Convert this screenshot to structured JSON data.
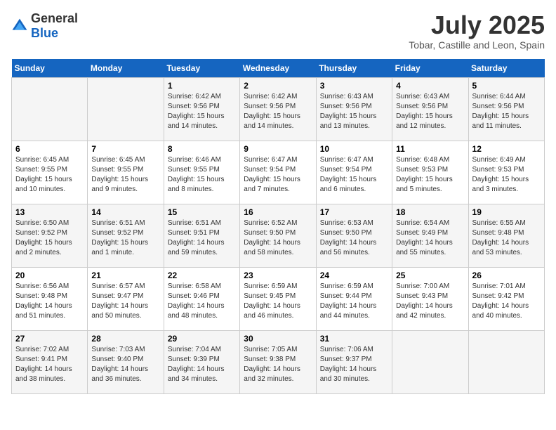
{
  "header": {
    "logo_general": "General",
    "logo_blue": "Blue",
    "month_year": "July 2025",
    "location": "Tobar, Castille and Leon, Spain"
  },
  "weekdays": [
    "Sunday",
    "Monday",
    "Tuesday",
    "Wednesday",
    "Thursday",
    "Friday",
    "Saturday"
  ],
  "weeks": [
    [
      {
        "day": "",
        "sunrise": "",
        "sunset": "",
        "daylight": ""
      },
      {
        "day": "",
        "sunrise": "",
        "sunset": "",
        "daylight": ""
      },
      {
        "day": "1",
        "sunrise": "Sunrise: 6:42 AM",
        "sunset": "Sunset: 9:56 PM",
        "daylight": "Daylight: 15 hours and 14 minutes."
      },
      {
        "day": "2",
        "sunrise": "Sunrise: 6:42 AM",
        "sunset": "Sunset: 9:56 PM",
        "daylight": "Daylight: 15 hours and 14 minutes."
      },
      {
        "day": "3",
        "sunrise": "Sunrise: 6:43 AM",
        "sunset": "Sunset: 9:56 PM",
        "daylight": "Daylight: 15 hours and 13 minutes."
      },
      {
        "day": "4",
        "sunrise": "Sunrise: 6:43 AM",
        "sunset": "Sunset: 9:56 PM",
        "daylight": "Daylight: 15 hours and 12 minutes."
      },
      {
        "day": "5",
        "sunrise": "Sunrise: 6:44 AM",
        "sunset": "Sunset: 9:56 PM",
        "daylight": "Daylight: 15 hours and 11 minutes."
      }
    ],
    [
      {
        "day": "6",
        "sunrise": "Sunrise: 6:45 AM",
        "sunset": "Sunset: 9:55 PM",
        "daylight": "Daylight: 15 hours and 10 minutes."
      },
      {
        "day": "7",
        "sunrise": "Sunrise: 6:45 AM",
        "sunset": "Sunset: 9:55 PM",
        "daylight": "Daylight: 15 hours and 9 minutes."
      },
      {
        "day": "8",
        "sunrise": "Sunrise: 6:46 AM",
        "sunset": "Sunset: 9:55 PM",
        "daylight": "Daylight: 15 hours and 8 minutes."
      },
      {
        "day": "9",
        "sunrise": "Sunrise: 6:47 AM",
        "sunset": "Sunset: 9:54 PM",
        "daylight": "Daylight: 15 hours and 7 minutes."
      },
      {
        "day": "10",
        "sunrise": "Sunrise: 6:47 AM",
        "sunset": "Sunset: 9:54 PM",
        "daylight": "Daylight: 15 hours and 6 minutes."
      },
      {
        "day": "11",
        "sunrise": "Sunrise: 6:48 AM",
        "sunset": "Sunset: 9:53 PM",
        "daylight": "Daylight: 15 hours and 5 minutes."
      },
      {
        "day": "12",
        "sunrise": "Sunrise: 6:49 AM",
        "sunset": "Sunset: 9:53 PM",
        "daylight": "Daylight: 15 hours and 3 minutes."
      }
    ],
    [
      {
        "day": "13",
        "sunrise": "Sunrise: 6:50 AM",
        "sunset": "Sunset: 9:52 PM",
        "daylight": "Daylight: 15 hours and 2 minutes."
      },
      {
        "day": "14",
        "sunrise": "Sunrise: 6:51 AM",
        "sunset": "Sunset: 9:52 PM",
        "daylight": "Daylight: 15 hours and 1 minute."
      },
      {
        "day": "15",
        "sunrise": "Sunrise: 6:51 AM",
        "sunset": "Sunset: 9:51 PM",
        "daylight": "Daylight: 14 hours and 59 minutes."
      },
      {
        "day": "16",
        "sunrise": "Sunrise: 6:52 AM",
        "sunset": "Sunset: 9:50 PM",
        "daylight": "Daylight: 14 hours and 58 minutes."
      },
      {
        "day": "17",
        "sunrise": "Sunrise: 6:53 AM",
        "sunset": "Sunset: 9:50 PM",
        "daylight": "Daylight: 14 hours and 56 minutes."
      },
      {
        "day": "18",
        "sunrise": "Sunrise: 6:54 AM",
        "sunset": "Sunset: 9:49 PM",
        "daylight": "Daylight: 14 hours and 55 minutes."
      },
      {
        "day": "19",
        "sunrise": "Sunrise: 6:55 AM",
        "sunset": "Sunset: 9:48 PM",
        "daylight": "Daylight: 14 hours and 53 minutes."
      }
    ],
    [
      {
        "day": "20",
        "sunrise": "Sunrise: 6:56 AM",
        "sunset": "Sunset: 9:48 PM",
        "daylight": "Daylight: 14 hours and 51 minutes."
      },
      {
        "day": "21",
        "sunrise": "Sunrise: 6:57 AM",
        "sunset": "Sunset: 9:47 PM",
        "daylight": "Daylight: 14 hours and 50 minutes."
      },
      {
        "day": "22",
        "sunrise": "Sunrise: 6:58 AM",
        "sunset": "Sunset: 9:46 PM",
        "daylight": "Daylight: 14 hours and 48 minutes."
      },
      {
        "day": "23",
        "sunrise": "Sunrise: 6:59 AM",
        "sunset": "Sunset: 9:45 PM",
        "daylight": "Daylight: 14 hours and 46 minutes."
      },
      {
        "day": "24",
        "sunrise": "Sunrise: 6:59 AM",
        "sunset": "Sunset: 9:44 PM",
        "daylight": "Daylight: 14 hours and 44 minutes."
      },
      {
        "day": "25",
        "sunrise": "Sunrise: 7:00 AM",
        "sunset": "Sunset: 9:43 PM",
        "daylight": "Daylight: 14 hours and 42 minutes."
      },
      {
        "day": "26",
        "sunrise": "Sunrise: 7:01 AM",
        "sunset": "Sunset: 9:42 PM",
        "daylight": "Daylight: 14 hours and 40 minutes."
      }
    ],
    [
      {
        "day": "27",
        "sunrise": "Sunrise: 7:02 AM",
        "sunset": "Sunset: 9:41 PM",
        "daylight": "Daylight: 14 hours and 38 minutes."
      },
      {
        "day": "28",
        "sunrise": "Sunrise: 7:03 AM",
        "sunset": "Sunset: 9:40 PM",
        "daylight": "Daylight: 14 hours and 36 minutes."
      },
      {
        "day": "29",
        "sunrise": "Sunrise: 7:04 AM",
        "sunset": "Sunset: 9:39 PM",
        "daylight": "Daylight: 14 hours and 34 minutes."
      },
      {
        "day": "30",
        "sunrise": "Sunrise: 7:05 AM",
        "sunset": "Sunset: 9:38 PM",
        "daylight": "Daylight: 14 hours and 32 minutes."
      },
      {
        "day": "31",
        "sunrise": "Sunrise: 7:06 AM",
        "sunset": "Sunset: 9:37 PM",
        "daylight": "Daylight: 14 hours and 30 minutes."
      },
      {
        "day": "",
        "sunrise": "",
        "sunset": "",
        "daylight": ""
      },
      {
        "day": "",
        "sunrise": "",
        "sunset": "",
        "daylight": ""
      }
    ]
  ]
}
